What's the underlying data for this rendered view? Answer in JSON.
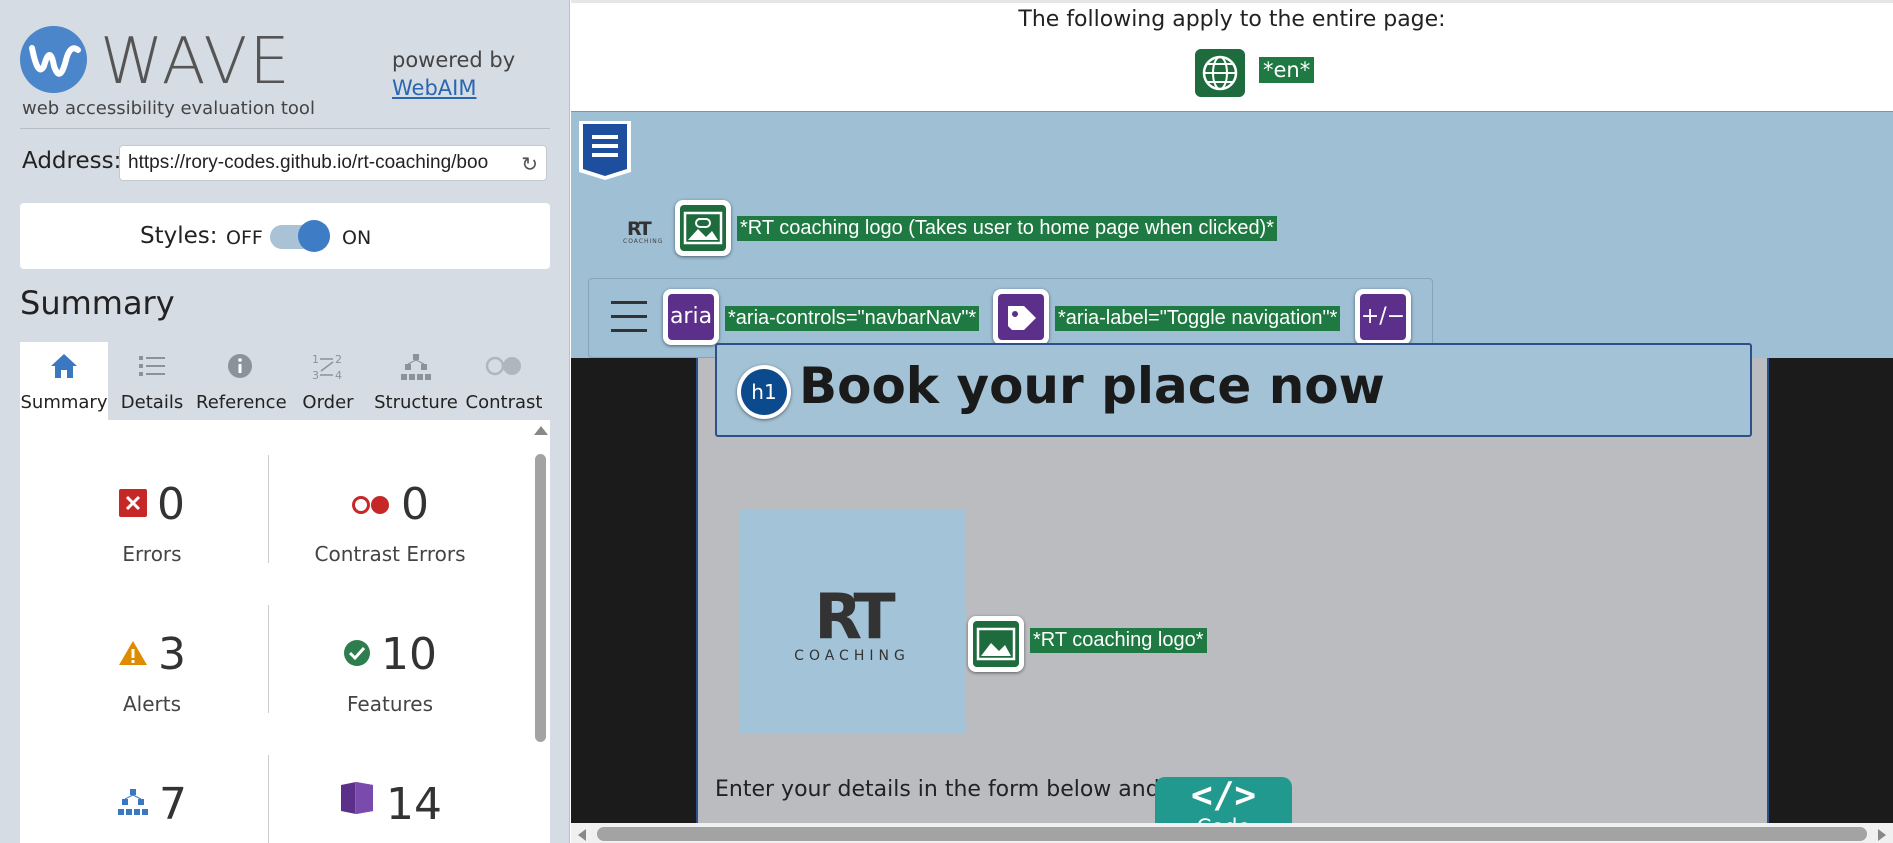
{
  "sidebar": {
    "logo_text": "WAVE",
    "tagline": "web accessibility evaluation tool",
    "powered_by": "powered by",
    "powered_link": "WebAIM",
    "address_label": "Address:",
    "address_value": "https://rory-codes.github.io/rt-coaching/boo",
    "styles_label": "Styles:",
    "styles_off": "OFF",
    "styles_on": "ON",
    "styles_state": "on",
    "summary_title": "Summary",
    "tabs": [
      {
        "label": "Summary",
        "icon": "home-icon",
        "active": true
      },
      {
        "label": "Details",
        "icon": "list-icon",
        "active": false
      },
      {
        "label": "Reference",
        "icon": "info-icon",
        "active": false
      },
      {
        "label": "Order",
        "icon": "order-icon",
        "active": false
      },
      {
        "label": "Structure",
        "icon": "structure-icon",
        "active": false
      },
      {
        "label": "Contrast",
        "icon": "contrast-icon",
        "active": false
      }
    ],
    "stats": {
      "errors": {
        "count": "0",
        "label": "Errors",
        "color": "#c62828"
      },
      "contrast_errors": {
        "count": "0",
        "label": "Contrast Errors",
        "color": "#c62828"
      },
      "alerts": {
        "count": "3",
        "label": "Alerts",
        "color": "#e08a00"
      },
      "features": {
        "count": "10",
        "label": "Features",
        "color": "#2e7d4f"
      },
      "structure": {
        "count": "7",
        "label": "",
        "color": "#3a78c2"
      },
      "aria": {
        "count": "14",
        "label": "",
        "color": "#5c2f8a"
      }
    }
  },
  "main": {
    "page_apply_text": "The following apply to the entire page:",
    "lang_tag": "*en*",
    "link_logo_tag": "*RT coaching logo (Takes user to home page when clicked)*",
    "aria_label_badge": "aria",
    "aria_controls_tag": "*aria-controls=\"navbarNav\"*",
    "aria_label_tag": "*aria-label=\"Toggle navigation\"*",
    "expand_badge": "+/−",
    "h1_badge": "h1",
    "heading": "Book your place now",
    "logo_rt": "RT",
    "logo_sub": "COACHING",
    "logo_alt_tag": "*RT coaching logo*",
    "intro_text": "Enter your details in the form below and press b",
    "code_glyph": "</>",
    "code_label": "Code"
  }
}
